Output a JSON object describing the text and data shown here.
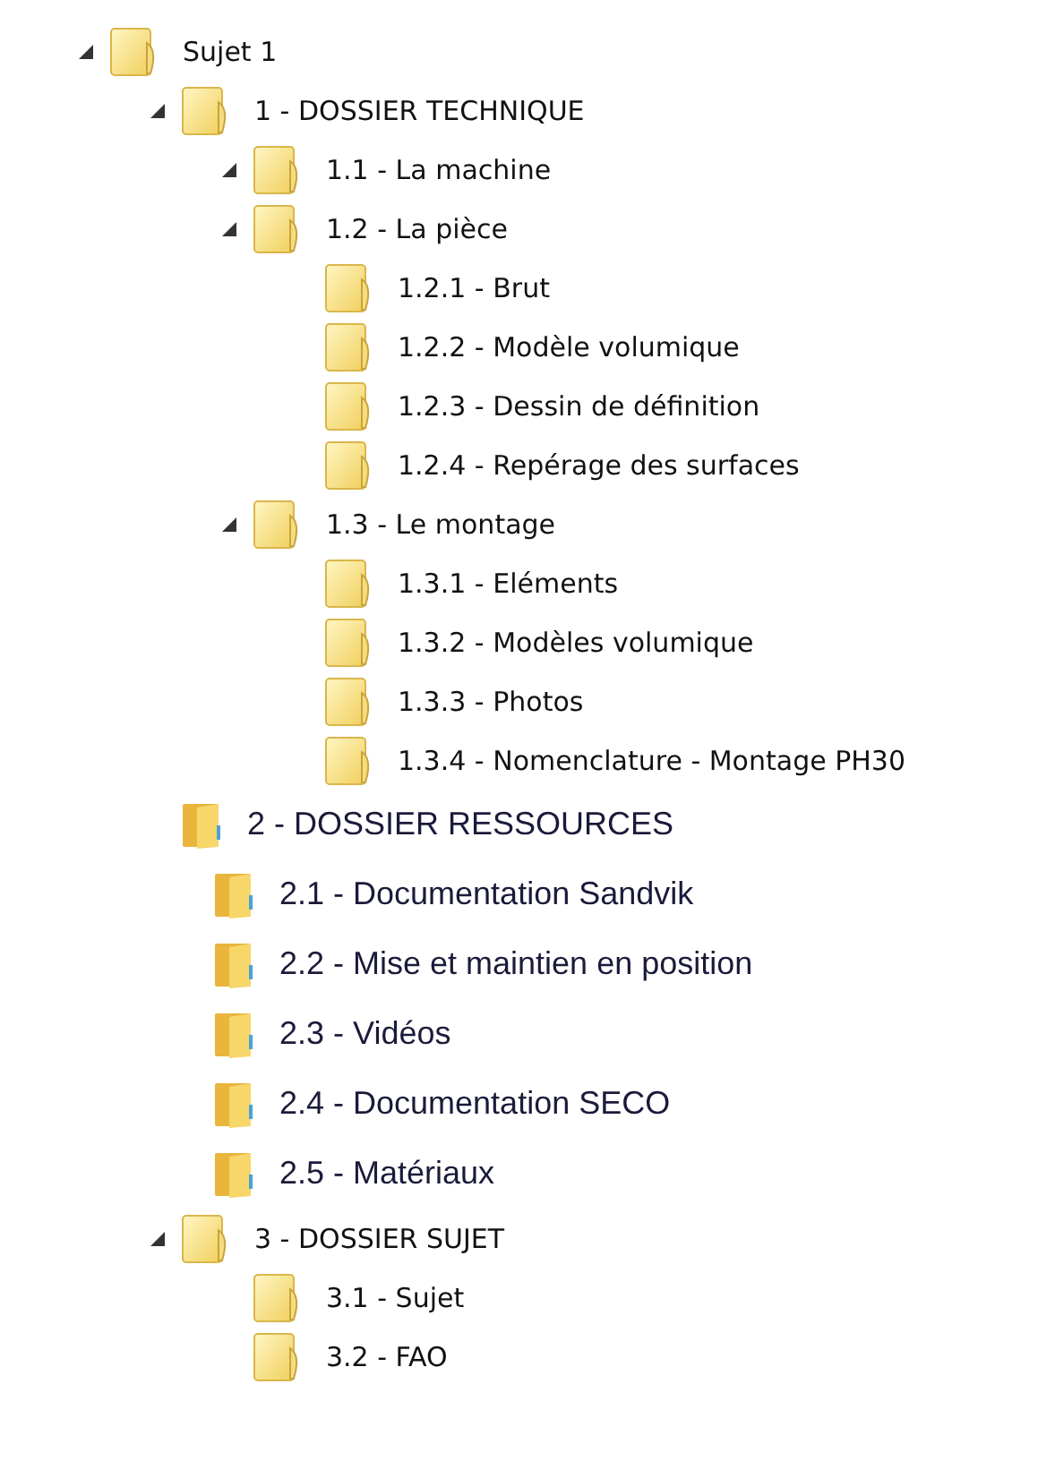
{
  "tree": [
    {
      "label": "Sujet 1",
      "kind": "classic",
      "expanded": true,
      "children": [
        {
          "label": "1 - DOSSIER TECHNIQUE",
          "kind": "classic",
          "expanded": true,
          "children": [
            {
              "label": "1.1 - La machine",
              "kind": "classic",
              "expanded": true
            },
            {
              "label": "1.2 - La pièce",
              "kind": "classic",
              "expanded": true,
              "children": [
                {
                  "label": "1.2.1 - Brut",
                  "kind": "classic"
                },
                {
                  "label": "1.2.2 - Modèle volumique",
                  "kind": "classic"
                },
                {
                  "label": "1.2.3 - Dessin de définition",
                  "kind": "classic"
                },
                {
                  "label": "1.2.4 - Repérage des surfaces",
                  "kind": "classic"
                }
              ]
            },
            {
              "label": "1.3 - Le montage",
              "kind": "classic",
              "expanded": true,
              "children": [
                {
                  "label": "1.3.1 - Eléments",
                  "kind": "classic"
                },
                {
                  "label": "1.3.2 - Modèles volumique",
                  "kind": "classic"
                },
                {
                  "label": "1.3.3 - Photos",
                  "kind": "classic"
                },
                {
                  "label": "1.3.4 - Nomenclature - Montage PH30",
                  "kind": "classic"
                }
              ]
            }
          ]
        },
        {
          "label": "2 - DOSSIER RESSOURCES",
          "kind": "modern",
          "children": [
            {
              "label": "2.1 - Documentation Sandvik",
              "kind": "modern"
            },
            {
              "label": "2.2 - Mise et maintien en position",
              "kind": "modern"
            },
            {
              "label": "2.3 - Vidéos",
              "kind": "modern"
            },
            {
              "label": "2.4 - Documentation SECO",
              "kind": "modern"
            },
            {
              "label": "2.5 - Matériaux",
              "kind": "modern"
            }
          ]
        },
        {
          "label": "3 - DOSSIER SUJET",
          "kind": "classic",
          "expanded": true,
          "children": [
            {
              "label": "3.1 - Sujet",
              "kind": "classic"
            },
            {
              "label": "3.2 - FAO",
              "kind": "classic"
            }
          ]
        }
      ]
    }
  ]
}
